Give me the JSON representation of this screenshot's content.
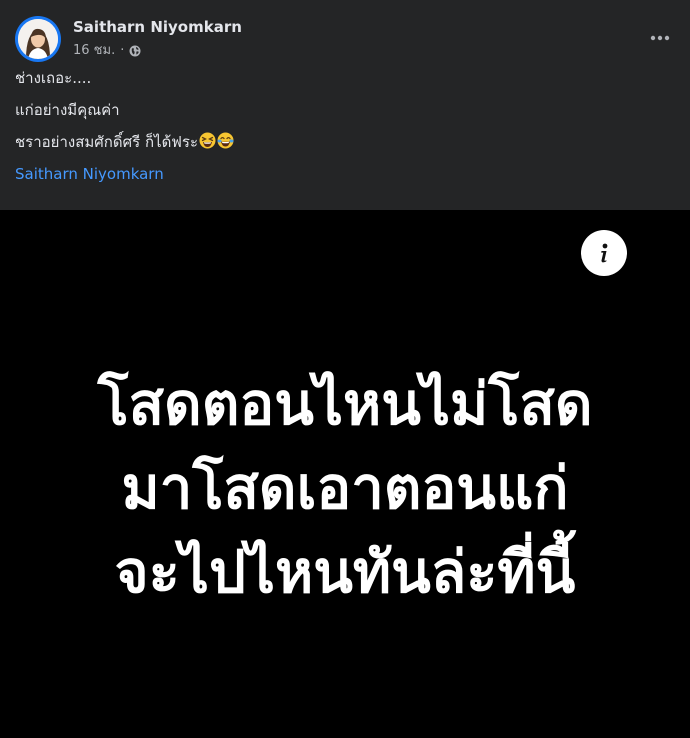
{
  "post": {
    "author": "Saitharn Niyomkarn",
    "time": "16 ชม.",
    "separator": "·",
    "privacy_icon": "globe-icon",
    "more_icon": "more-options-icon",
    "lines": [
      "ช่างเถอะ....",
      "แก่อย่างมีคุณค่า",
      "ชราอย่างสมศักดิ์ศรี ก็ได้ฟระ"
    ],
    "emojis": [
      "grinning-squinting-face",
      "face-with-tears-of-joy"
    ],
    "tag": "Saitharn Niyomkarn"
  },
  "image": {
    "info_icon": "info-icon",
    "lines": [
      "โสดตอนไหนไม่โสด",
      "มาโสดเอาตอนแก่",
      "จะไปไหนทันล่ะที่นี้"
    ]
  },
  "colors": {
    "background": "#242526",
    "text": "#e4e6eb",
    "secondary": "#b0b3b8",
    "link": "#4599ff",
    "image_bg": "#000000"
  }
}
